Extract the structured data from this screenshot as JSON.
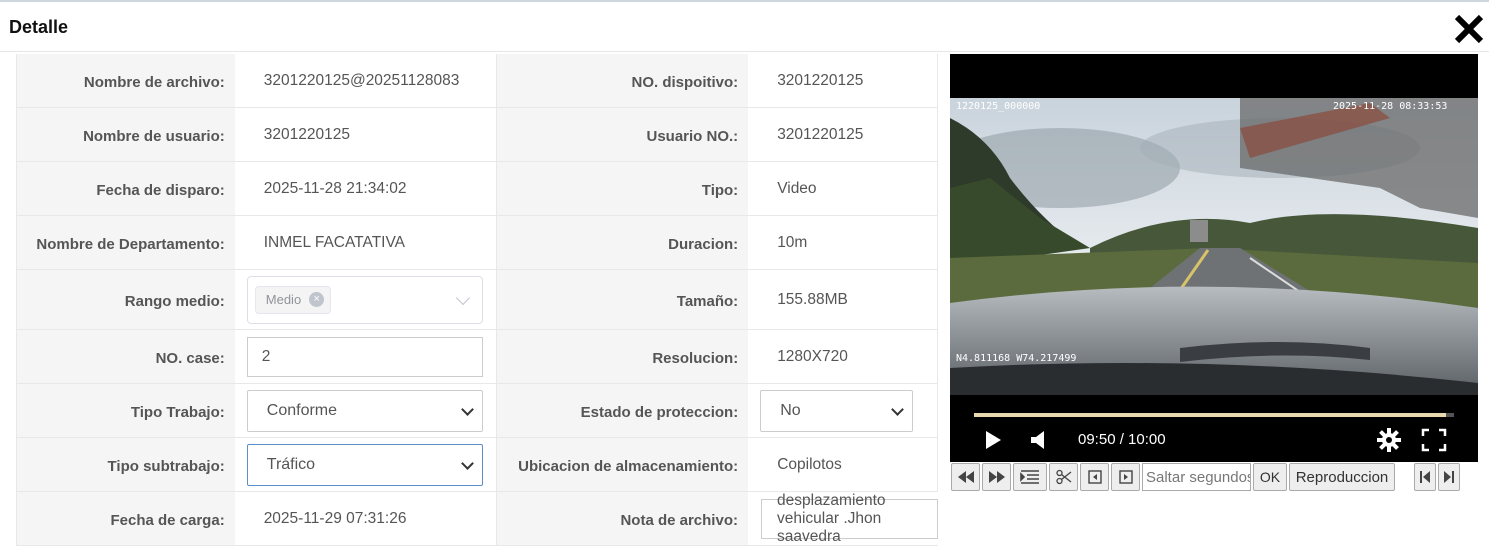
{
  "window": {
    "title": "Detalle"
  },
  "fields": {
    "nombre_archivo": {
      "label": "Nombre de archivo:",
      "value": "3201220125@20251128083"
    },
    "no_dispositivo": {
      "label": "NO. dispoitivo:",
      "value": "3201220125"
    },
    "nombre_usuario": {
      "label": "Nombre de usuario:",
      "value": "3201220125"
    },
    "usuario_no": {
      "label": "Usuario NO.:",
      "value": "3201220125"
    },
    "fecha_disparo": {
      "label": "Fecha de disparo:",
      "value": "2025-11-28 21:34:02"
    },
    "tipo": {
      "label": "Tipo:",
      "value": "Video"
    },
    "departamento": {
      "label": "Nombre de Departamento:",
      "value": "INMEL FACATATIVA"
    },
    "duracion": {
      "label": "Duracion:",
      "value": "10m"
    },
    "rango_medio": {
      "label": "Rango medio:",
      "tag": "Medio"
    },
    "tamano": {
      "label": "Tamaño:",
      "value": "155.88MB"
    },
    "no_case": {
      "label": "NO. case:",
      "value": "2"
    },
    "resolucion": {
      "label": "Resolucion:",
      "value": "1280X720"
    },
    "tipo_trabajo": {
      "label": "Tipo Trabajo:",
      "selected": "Conforme"
    },
    "estado_proteccion": {
      "label": "Estado de proteccion:",
      "selected": "No"
    },
    "tipo_subtrabajo": {
      "label": "Tipo subtrabajo:",
      "selected": "Tráfico"
    },
    "ubicacion": {
      "label": "Ubicacion de almacenamiento:",
      "value": "Copilotos"
    },
    "fecha_carga": {
      "label": "Fecha de carga:",
      "value": "2025-11-29 07:31:26"
    },
    "nota_archivo": {
      "label": "Nota de archivo:",
      "value": "desplazamiento vehicular .Jhon saavedra"
    }
  },
  "video": {
    "osd_top_left": "1220125_000000",
    "osd_top_right": "2025-11-28 08:33:53",
    "osd_bottom_left": "N4.811168 W74.217499",
    "time_display": "09:50 / 10:00",
    "progress_fraction": 0.983
  },
  "toolbar": {
    "jump_placeholder": "Saltar segundos",
    "ok_label": "OK",
    "playback_label": "Reproduccion"
  },
  "icons": [
    "close-icon",
    "play-icon",
    "volume-icon",
    "settings-icon",
    "fullscreen-icon",
    "rewind-icon",
    "fast-forward-icon",
    "list-icon",
    "scissors-icon",
    "frame-back-icon",
    "frame-forward-icon",
    "skip-start-icon",
    "skip-end-icon"
  ]
}
